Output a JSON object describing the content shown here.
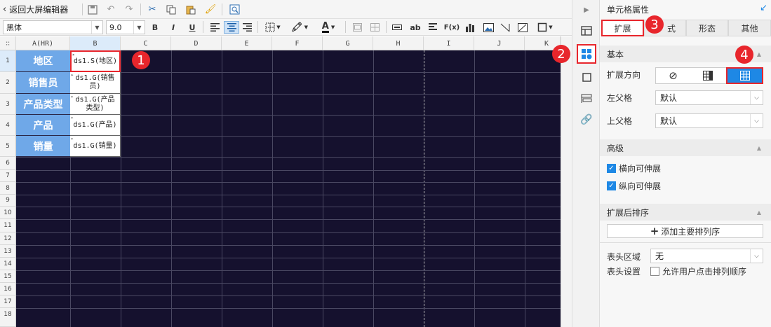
{
  "toolbar": {
    "back_label": "返回大屏编辑器",
    "font_family": "黑体",
    "font_size": "9.0",
    "bold": "B",
    "italic": "I",
    "underline": "U",
    "abc_label": "ab",
    "fx_label": "F(x)"
  },
  "columns": [
    "A(HR)",
    "B",
    "C",
    "D",
    "E",
    "F",
    "G",
    "H",
    "I",
    "J",
    "K"
  ],
  "rows": [
    "1",
    "2",
    "3",
    "4",
    "5",
    "6",
    "7",
    "8",
    "9",
    "10",
    "11",
    "12",
    "13",
    "14",
    "15",
    "16",
    "17",
    "18"
  ],
  "cells": {
    "a1": "地区",
    "a2": "销售员",
    "a3": "产品类型",
    "a4": "产品",
    "a5": "销量",
    "b1": "ds1.S(地区)",
    "b2_l1": "ds1.G(销售",
    "b2_l2": "员)",
    "b3_l1": "ds1.G(产品",
    "b3_l2": "类型)",
    "b4": "ds1.G(产品)",
    "b5": "ds1.G(销量)"
  },
  "badges": [
    "1",
    "2",
    "3",
    "4"
  ],
  "panel": {
    "title": "单元格属性",
    "tabs": [
      "扩展",
      "样式",
      "形态",
      "其他"
    ],
    "tabs_visible": [
      "扩展",
      "式",
      "形态",
      "其他"
    ],
    "active_tab": "扩展",
    "basic_section": "基本",
    "expand_dir_label": "扩展方向",
    "left_parent_label": "左父格",
    "left_parent_value": "默认",
    "top_parent_label": "上父格",
    "top_parent_value": "默认",
    "advanced_section": "高级",
    "h_stretch_label": "横向可伸展",
    "v_stretch_label": "纵向可伸展",
    "sort_section": "扩展后排序",
    "add_sort_label": "添加主要排列序",
    "header_area_label": "表头区域",
    "header_area_value": "无",
    "header_setting_label": "表头设置",
    "allow_sort_label": "允许用户点击排列顺序"
  },
  "colors": {
    "accent": "#1e88e5",
    "highlight": "#e8262c",
    "sheet_bg": "#15112e",
    "label_cell": "#6fa8e8"
  }
}
